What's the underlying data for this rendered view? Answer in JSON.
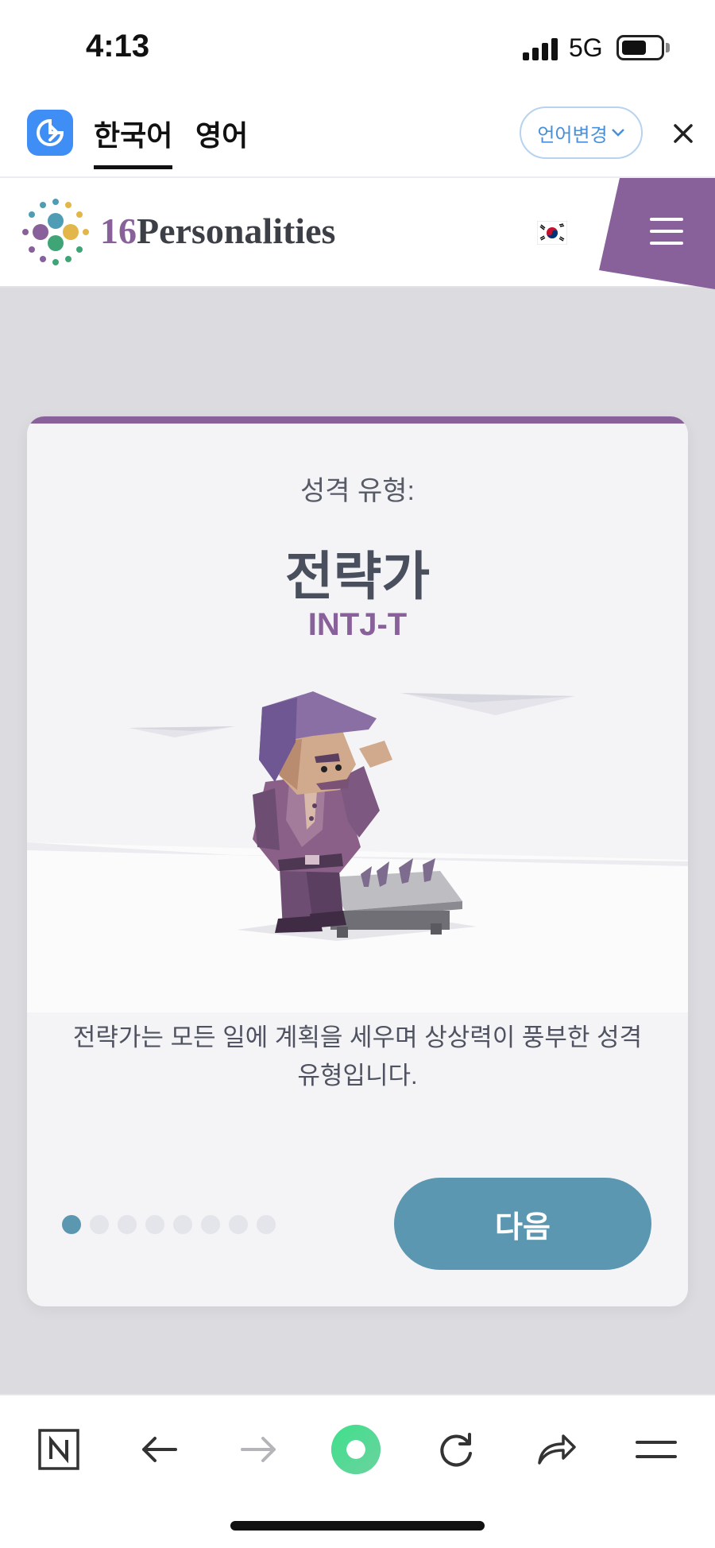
{
  "status_bar": {
    "time": "4:13",
    "network": "5G"
  },
  "translate_bar": {
    "tabs": [
      {
        "label": "한국어",
        "active": true
      },
      {
        "label": "영어",
        "active": false
      }
    ],
    "change_language_label": "언어변경",
    "close_icon": "close-icon"
  },
  "site_header": {
    "logo_number": "16",
    "logo_word": "Personalities",
    "flag": "south-korea-flag-icon",
    "menu_icon": "hamburger-menu-icon",
    "accent_color": "#88619a"
  },
  "card": {
    "subtitle": "성격 유형:",
    "title": "전략가",
    "code": "INTJ-T",
    "description_line1": "전략가는 모든 일에 계획을 세우며 상상력이 풍부한 성격",
    "description_line2": "유형입니다.",
    "pager": {
      "total": 8,
      "active_index": 0
    },
    "next_label": "다음",
    "button_color": "#5b97b1"
  },
  "bottom_toolbar": {
    "items": [
      "naver-n-icon",
      "back-arrow-icon",
      "forward-arrow-icon",
      "home-circle-icon",
      "reload-icon",
      "share-icon",
      "menu-icon"
    ]
  }
}
